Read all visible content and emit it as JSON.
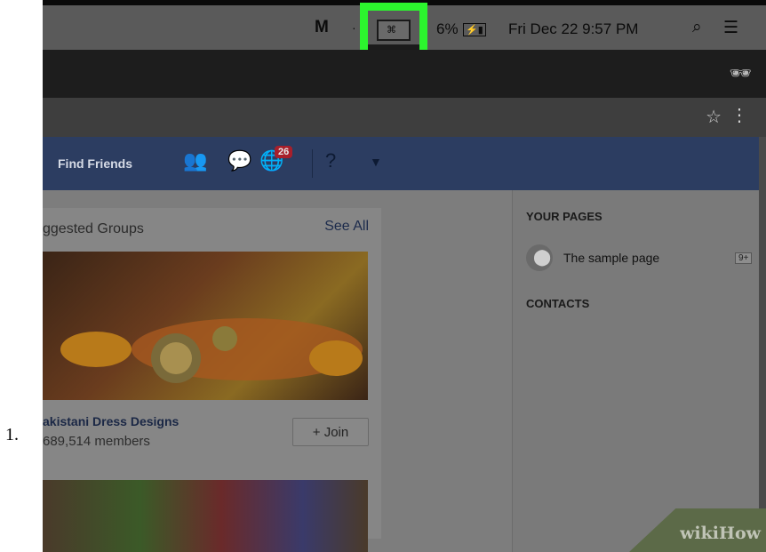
{
  "list_marker": "1.",
  "menubar": {
    "malware_icon": "M",
    "battery_text": "6%",
    "battery_icon": "battery-charging-icon",
    "datetime": "Fri Dec 22  9:57 PM",
    "search_icon": "magnifier",
    "list_icon": "list"
  },
  "highlight": {
    "color": "#2cf52e",
    "target": "screen-mirroring-menu-icon"
  },
  "toolbar": {
    "incognito_icon": "incognito",
    "bookmark_icon": "star",
    "menu_icon": "kebab-menu"
  },
  "facebook_nav": {
    "find_friends": "Find Friends",
    "notifications_count": "26"
  },
  "suggested_groups": {
    "title": "ggested Groups",
    "see_all": "See All",
    "group": {
      "name": "akistani Dress Designs",
      "members": "689,514 members",
      "join_label": "+ Join"
    }
  },
  "sidebar": {
    "your_pages_heading": "YOUR PAGES",
    "page_name": "The sample page",
    "page_count": "9+",
    "contacts_heading": "CONTACTS"
  },
  "watermark": "wikiHow"
}
